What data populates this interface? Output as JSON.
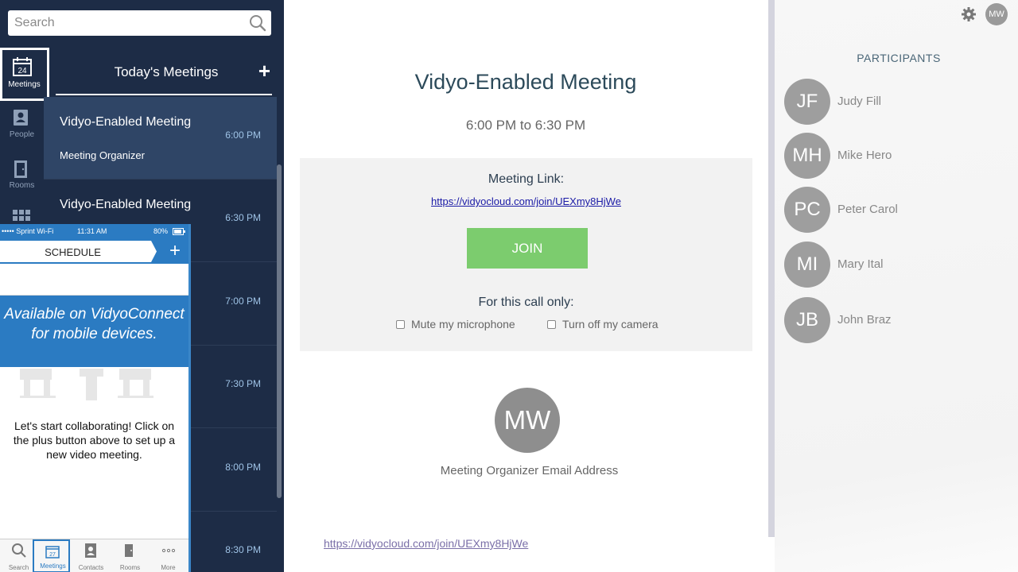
{
  "search": {
    "placeholder": "Search"
  },
  "rail": {
    "items": [
      {
        "label": "Meetings",
        "badge": "24"
      },
      {
        "label": "People"
      },
      {
        "label": "Rooms"
      }
    ]
  },
  "meetings_list": {
    "header": "Today's Meetings",
    "add_label": "+",
    "items": [
      {
        "title": "Vidyo-Enabled Meeting",
        "time": "6:00 PM",
        "organizer": "Meeting Organizer"
      },
      {
        "title": "Vidyo-Enabled Meeting",
        "time": "6:30 PM"
      },
      {
        "time": "7:00 PM"
      },
      {
        "time": "7:30 PM"
      },
      {
        "time": "8:00 PM"
      },
      {
        "time": "8:30 PM"
      }
    ]
  },
  "phone": {
    "status": {
      "carrier": "••••• Sprint Wi-Fi",
      "time": "11:31 AM",
      "battery": "80%"
    },
    "schedule_label": "SCHEDULE",
    "plus_label": "+",
    "banner_line1": "Available on VidyoConnect",
    "banner_line2": "for mobile devices.",
    "collab_text": "Let's start collaborating! Click on the plus button above to set up a new video meeting.",
    "tabs": [
      {
        "label": "Search"
      },
      {
        "label": "Meetings",
        "badge": "27"
      },
      {
        "label": "Contacts"
      },
      {
        "label": "Rooms"
      },
      {
        "label": "More"
      }
    ]
  },
  "meeting": {
    "title": "Vidyo-Enabled Meeting",
    "time_range": "6:00 PM to 6:30 PM",
    "link_label": "Meeting Link:",
    "link": "https://vidyocloud.com/join/UEXmy8HjWe",
    "join_label": "JOIN",
    "for_call_label": "For this call only:",
    "mute_label": "Mute my microphone",
    "camera_label": "Turn off my camera",
    "organizer_initials": "MW",
    "organizer_email": "Meeting Organizer Email Address",
    "bottom_link": "https://vidyocloud.com/join/UEXmy8HjWe"
  },
  "participants": {
    "header": "PARTICIPANTS",
    "me_initials": "MW",
    "items": [
      {
        "initials": "JF",
        "name": "Judy Fill"
      },
      {
        "initials": "MH",
        "name": "Mike Hero"
      },
      {
        "initials": "PC",
        "name": "Peter Carol"
      },
      {
        "initials": "MI",
        "name": "Mary Ital"
      },
      {
        "initials": "JB",
        "name": "John Braz"
      }
    ]
  },
  "colors": {
    "sidebar": "#1d2c46",
    "selected_meeting": "#2f4566",
    "join_button": "#7ccc6e",
    "phone_blue": "#2b7bc2",
    "avatar_gray": "#9e9e9e"
  }
}
